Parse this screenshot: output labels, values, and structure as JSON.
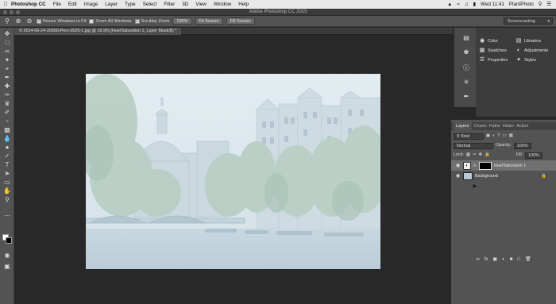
{
  "menubar": {
    "app": "Photoshop CC",
    "items": [
      "File",
      "Edit",
      "Image",
      "Layer",
      "Type",
      "Select",
      "Filter",
      "3D",
      "View",
      "Window",
      "Help"
    ],
    "clock": "Wed 11:41",
    "user": "PlantPhoto"
  },
  "window": {
    "title": "Adobe Photoshop CC 2015"
  },
  "options": {
    "resize_windows": "Resize Windows to Fit",
    "zoom_all_windows": "Zoom All Windows",
    "scrubby_zoom": "Scrubby Zoom",
    "zoom_100": "100%",
    "fit_screen": "Fit Screen",
    "fill_screen": "Fill Screen",
    "workspace": "Screencasting"
  },
  "document": {
    "tab": "© 2014-06-24-20000-Pers-0025-1.jpg @ 16.9% (Hue/Saturation 1, Layer Mask/8) *"
  },
  "panels": {
    "color": "Color",
    "swatches": "Swatches",
    "properties": "Properties",
    "libraries": "Libraries",
    "adjustments": "Adjustments",
    "styles": "Styles"
  },
  "layers_panel": {
    "tabs": [
      "Layers",
      "Chann",
      "Paths",
      "Histor",
      "Action"
    ],
    "filter_kind": "Kind",
    "blend_mode": "Normal",
    "opacity_label": "Opacity:",
    "opacity_value": "100%",
    "lock_label": "Lock:",
    "fill_label": "Fill:",
    "fill_value": "100%",
    "layers": [
      {
        "name": "Hue/Saturation 1",
        "selected": true
      },
      {
        "name": "Background",
        "selected": false
      }
    ]
  }
}
